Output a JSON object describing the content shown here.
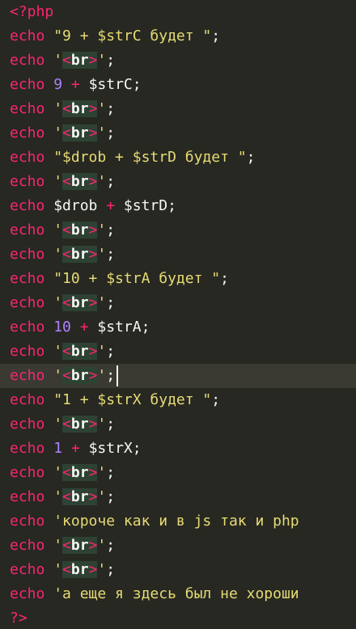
{
  "editor": {
    "colors": {
      "background": "#272822",
      "keyword": "#f92672",
      "string": "#e6db74",
      "number": "#ae81ff",
      "text": "#f8f8f2",
      "active_line": "#3a3a33",
      "br_highlight": "#2e4234"
    },
    "active_line": 15,
    "lines": [
      {
        "tokens": [
          {
            "t": "<?php",
            "c": "tag"
          }
        ]
      },
      {
        "tokens": [
          {
            "t": "echo",
            "c": "kw"
          },
          {
            "t": " ",
            "c": "punc"
          },
          {
            "t": "\"9 + $strC будет \"",
            "c": "str"
          },
          {
            "t": ";",
            "c": "punc"
          }
        ]
      },
      {
        "tokens": [
          {
            "t": "echo",
            "c": "kw"
          },
          {
            "t": " ",
            "c": "punc"
          },
          {
            "t": "'",
            "c": "str"
          },
          {
            "t": "<br>",
            "c": "br"
          },
          {
            "t": "'",
            "c": "str"
          },
          {
            "t": ";",
            "c": "punc"
          }
        ]
      },
      {
        "tokens": [
          {
            "t": "echo",
            "c": "kw"
          },
          {
            "t": " ",
            "c": "punc"
          },
          {
            "t": "9",
            "c": "num"
          },
          {
            "t": " ",
            "c": "punc"
          },
          {
            "t": "+",
            "c": "op"
          },
          {
            "t": " ",
            "c": "punc"
          },
          {
            "t": "$strC",
            "c": "var"
          },
          {
            "t": ";",
            "c": "punc"
          }
        ]
      },
      {
        "tokens": [
          {
            "t": "echo",
            "c": "kw"
          },
          {
            "t": " ",
            "c": "punc"
          },
          {
            "t": "'",
            "c": "str"
          },
          {
            "t": "<br>",
            "c": "br"
          },
          {
            "t": "'",
            "c": "str"
          },
          {
            "t": ";",
            "c": "punc"
          }
        ]
      },
      {
        "tokens": [
          {
            "t": "echo",
            "c": "kw"
          },
          {
            "t": " ",
            "c": "punc"
          },
          {
            "t": "'",
            "c": "str"
          },
          {
            "t": "<br>",
            "c": "br"
          },
          {
            "t": "'",
            "c": "str"
          },
          {
            "t": ";",
            "c": "punc"
          }
        ]
      },
      {
        "tokens": [
          {
            "t": "echo",
            "c": "kw"
          },
          {
            "t": " ",
            "c": "punc"
          },
          {
            "t": "\"$drob + $strD будет \"",
            "c": "str"
          },
          {
            "t": ";",
            "c": "punc"
          }
        ]
      },
      {
        "tokens": [
          {
            "t": "echo",
            "c": "kw"
          },
          {
            "t": " ",
            "c": "punc"
          },
          {
            "t": "'",
            "c": "str"
          },
          {
            "t": "<br>",
            "c": "br"
          },
          {
            "t": "'",
            "c": "str"
          },
          {
            "t": ";",
            "c": "punc"
          }
        ]
      },
      {
        "tokens": [
          {
            "t": "echo",
            "c": "kw"
          },
          {
            "t": " ",
            "c": "punc"
          },
          {
            "t": "$drob",
            "c": "var"
          },
          {
            "t": " ",
            "c": "punc"
          },
          {
            "t": "+",
            "c": "op"
          },
          {
            "t": " ",
            "c": "punc"
          },
          {
            "t": "$strD",
            "c": "var"
          },
          {
            "t": ";",
            "c": "punc"
          }
        ]
      },
      {
        "tokens": [
          {
            "t": "echo",
            "c": "kw"
          },
          {
            "t": " ",
            "c": "punc"
          },
          {
            "t": "'",
            "c": "str"
          },
          {
            "t": "<br>",
            "c": "br"
          },
          {
            "t": "'",
            "c": "str"
          },
          {
            "t": ";",
            "c": "punc"
          }
        ]
      },
      {
        "tokens": [
          {
            "t": "echo",
            "c": "kw"
          },
          {
            "t": " ",
            "c": "punc"
          },
          {
            "t": "'",
            "c": "str"
          },
          {
            "t": "<br>",
            "c": "br"
          },
          {
            "t": "'",
            "c": "str"
          },
          {
            "t": ";",
            "c": "punc"
          }
        ]
      },
      {
        "tokens": [
          {
            "t": "echo",
            "c": "kw"
          },
          {
            "t": " ",
            "c": "punc"
          },
          {
            "t": "\"10 + $strA будет \"",
            "c": "str"
          },
          {
            "t": ";",
            "c": "punc"
          }
        ]
      },
      {
        "tokens": [
          {
            "t": "echo",
            "c": "kw"
          },
          {
            "t": " ",
            "c": "punc"
          },
          {
            "t": "'",
            "c": "str"
          },
          {
            "t": "<br>",
            "c": "br"
          },
          {
            "t": "'",
            "c": "str"
          },
          {
            "t": ";",
            "c": "punc"
          }
        ]
      },
      {
        "tokens": [
          {
            "t": "echo",
            "c": "kw"
          },
          {
            "t": " ",
            "c": "punc"
          },
          {
            "t": "10",
            "c": "num"
          },
          {
            "t": " ",
            "c": "punc"
          },
          {
            "t": "+",
            "c": "op"
          },
          {
            "t": " ",
            "c": "punc"
          },
          {
            "t": "$strA",
            "c": "var"
          },
          {
            "t": ";",
            "c": "punc"
          }
        ]
      },
      {
        "tokens": [
          {
            "t": "echo",
            "c": "kw"
          },
          {
            "t": " ",
            "c": "punc"
          },
          {
            "t": "'",
            "c": "str"
          },
          {
            "t": "<br>",
            "c": "br"
          },
          {
            "t": "'",
            "c": "str"
          },
          {
            "t": ";",
            "c": "punc"
          }
        ]
      },
      {
        "tokens": [
          {
            "t": "echo",
            "c": "kw"
          },
          {
            "t": " ",
            "c": "punc"
          },
          {
            "t": "'",
            "c": "str"
          },
          {
            "t": "<br>",
            "c": "br"
          },
          {
            "t": "'",
            "c": "str"
          },
          {
            "t": ";",
            "c": "punc"
          }
        ]
      },
      {
        "tokens": [
          {
            "t": "echo",
            "c": "kw"
          },
          {
            "t": " ",
            "c": "punc"
          },
          {
            "t": "\"1 + $strX будет \"",
            "c": "str"
          },
          {
            "t": ";",
            "c": "punc"
          }
        ]
      },
      {
        "tokens": [
          {
            "t": "echo",
            "c": "kw"
          },
          {
            "t": " ",
            "c": "punc"
          },
          {
            "t": "'",
            "c": "str"
          },
          {
            "t": "<br>",
            "c": "br"
          },
          {
            "t": "'",
            "c": "str"
          },
          {
            "t": ";",
            "c": "punc"
          }
        ]
      },
      {
        "tokens": [
          {
            "t": "echo",
            "c": "kw"
          },
          {
            "t": " ",
            "c": "punc"
          },
          {
            "t": "1",
            "c": "num"
          },
          {
            "t": " ",
            "c": "punc"
          },
          {
            "t": "+",
            "c": "op"
          },
          {
            "t": " ",
            "c": "punc"
          },
          {
            "t": "$strX",
            "c": "var"
          },
          {
            "t": ";",
            "c": "punc"
          }
        ]
      },
      {
        "tokens": [
          {
            "t": "echo",
            "c": "kw"
          },
          {
            "t": " ",
            "c": "punc"
          },
          {
            "t": "'",
            "c": "str"
          },
          {
            "t": "<br>",
            "c": "br"
          },
          {
            "t": "'",
            "c": "str"
          },
          {
            "t": ";",
            "c": "punc"
          }
        ]
      },
      {
        "tokens": [
          {
            "t": "echo",
            "c": "kw"
          },
          {
            "t": " ",
            "c": "punc"
          },
          {
            "t": "'",
            "c": "str"
          },
          {
            "t": "<br>",
            "c": "br"
          },
          {
            "t": "'",
            "c": "str"
          },
          {
            "t": ";",
            "c": "punc"
          }
        ]
      },
      {
        "tokens": [
          {
            "t": "echo",
            "c": "kw"
          },
          {
            "t": " ",
            "c": "punc"
          },
          {
            "t": "'короче как и в js так и php",
            "c": "str"
          }
        ]
      },
      {
        "tokens": [
          {
            "t": "echo",
            "c": "kw"
          },
          {
            "t": " ",
            "c": "punc"
          },
          {
            "t": "'",
            "c": "str"
          },
          {
            "t": "<br>",
            "c": "br"
          },
          {
            "t": "'",
            "c": "str"
          },
          {
            "t": ";",
            "c": "punc"
          }
        ]
      },
      {
        "tokens": [
          {
            "t": "echo",
            "c": "kw"
          },
          {
            "t": " ",
            "c": "punc"
          },
          {
            "t": "'",
            "c": "str"
          },
          {
            "t": "<br>",
            "c": "br"
          },
          {
            "t": "'",
            "c": "str"
          },
          {
            "t": ";",
            "c": "punc"
          }
        ]
      },
      {
        "tokens": [
          {
            "t": "echo",
            "c": "kw"
          },
          {
            "t": " ",
            "c": "punc"
          },
          {
            "t": "'а еще я здесь был не хороши",
            "c": "str"
          }
        ]
      },
      {
        "tokens": [
          {
            "t": "?>",
            "c": "tag"
          }
        ]
      }
    ]
  }
}
